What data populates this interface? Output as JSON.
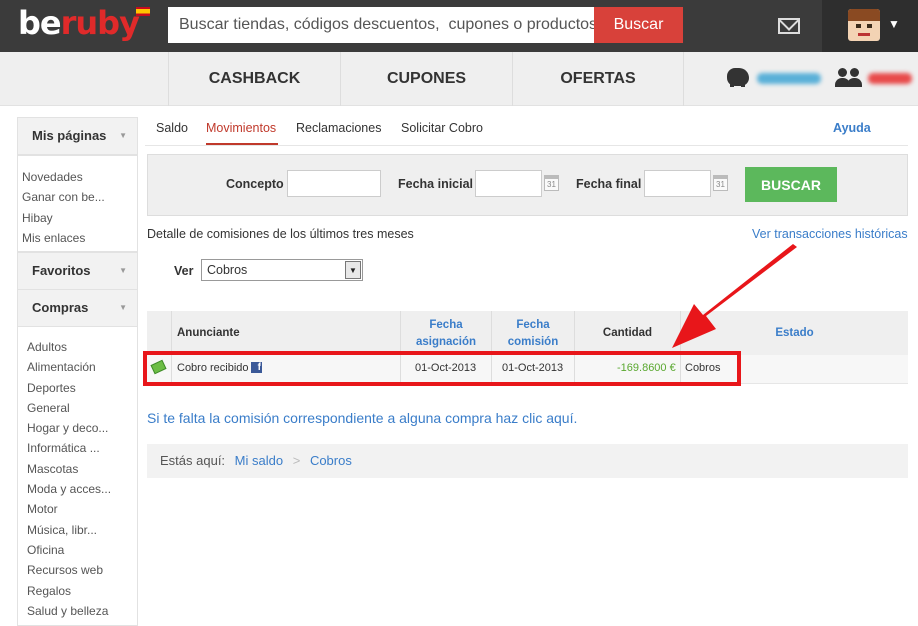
{
  "header": {
    "logo_prefix": "be",
    "logo_suffix": "ruby",
    "search_placeholder": "Buscar tiendas, códigos descuentos,  cupones o productos",
    "search_button": "Buscar",
    "icons": [
      "envelope-icon",
      "avatar",
      "caret-down-icon"
    ]
  },
  "nav": {
    "tabs": [
      {
        "label": "CASHBACK"
      },
      {
        "label": "CUPONES"
      },
      {
        "label": "OFERTAS"
      }
    ]
  },
  "sidebar": {
    "sections": [
      {
        "title": "Mis páginas",
        "items": [
          "Novedades",
          "Ganar con be...",
          "Hibay",
          "Mis enlaces"
        ]
      },
      {
        "title": "Favoritos",
        "items": []
      },
      {
        "title": "Compras",
        "items": [
          "Adultos",
          "Alimentación",
          "Deportes",
          "General",
          "Hogar y deco...",
          "Informática ...",
          "Mascotas",
          "Moda y acces...",
          "Motor",
          "Música, libr...",
          "Oficina",
          "Recursos web",
          "Regalos",
          "Salud y belleza"
        ]
      }
    ]
  },
  "subtabs": {
    "items": [
      "Saldo",
      "Movimientos",
      "Reclamaciones",
      "Solicitar Cobro"
    ],
    "active": "Movimientos",
    "help": "Ayuda"
  },
  "filters": {
    "concepto_label": "Concepto",
    "concepto_value": "",
    "fecha_inicial_label": "Fecha inicial",
    "fecha_inicial_value": "",
    "fecha_final_label": "Fecha final",
    "fecha_final_value": "",
    "calendar_text": "31",
    "button": "BUSCAR"
  },
  "detail": {
    "text": "Detalle de comisiones de los últimos tres meses",
    "history_link": "Ver transacciones históricas",
    "ver_label": "Ver",
    "ver_selected": "Cobros"
  },
  "table": {
    "headers": {
      "anunciante": "Anunciante",
      "fecha_asignacion_1": "Fecha",
      "fecha_asignacion_2": "asignación",
      "fecha_comision_1": "Fecha",
      "fecha_comision_2": "comisión",
      "cantidad": "Cantidad",
      "estado": "Estado"
    },
    "rows": [
      {
        "anunciante": "Cobro recibido",
        "fecha_asignacion": "01-Oct-2013",
        "fecha_comision": "01-Oct-2013",
        "cantidad": "-169.8600 €",
        "estado": "Cobros"
      }
    ]
  },
  "missing_commission_link": "Si te falta la comisión correspondiente a alguna compra haz clic aquí.",
  "breadcrumb": {
    "prefix": "Estás aquí:",
    "items": [
      "Mi saldo",
      "Cobros"
    ],
    "separator": ">"
  },
  "colors": {
    "topbar": "#3b3b3b",
    "accent_red": "#d8413a",
    "link_blue": "#3a7dc9",
    "buscar_green": "#5cb85c",
    "amount_green": "#5aa830",
    "highlight_red": "#e8161a"
  }
}
